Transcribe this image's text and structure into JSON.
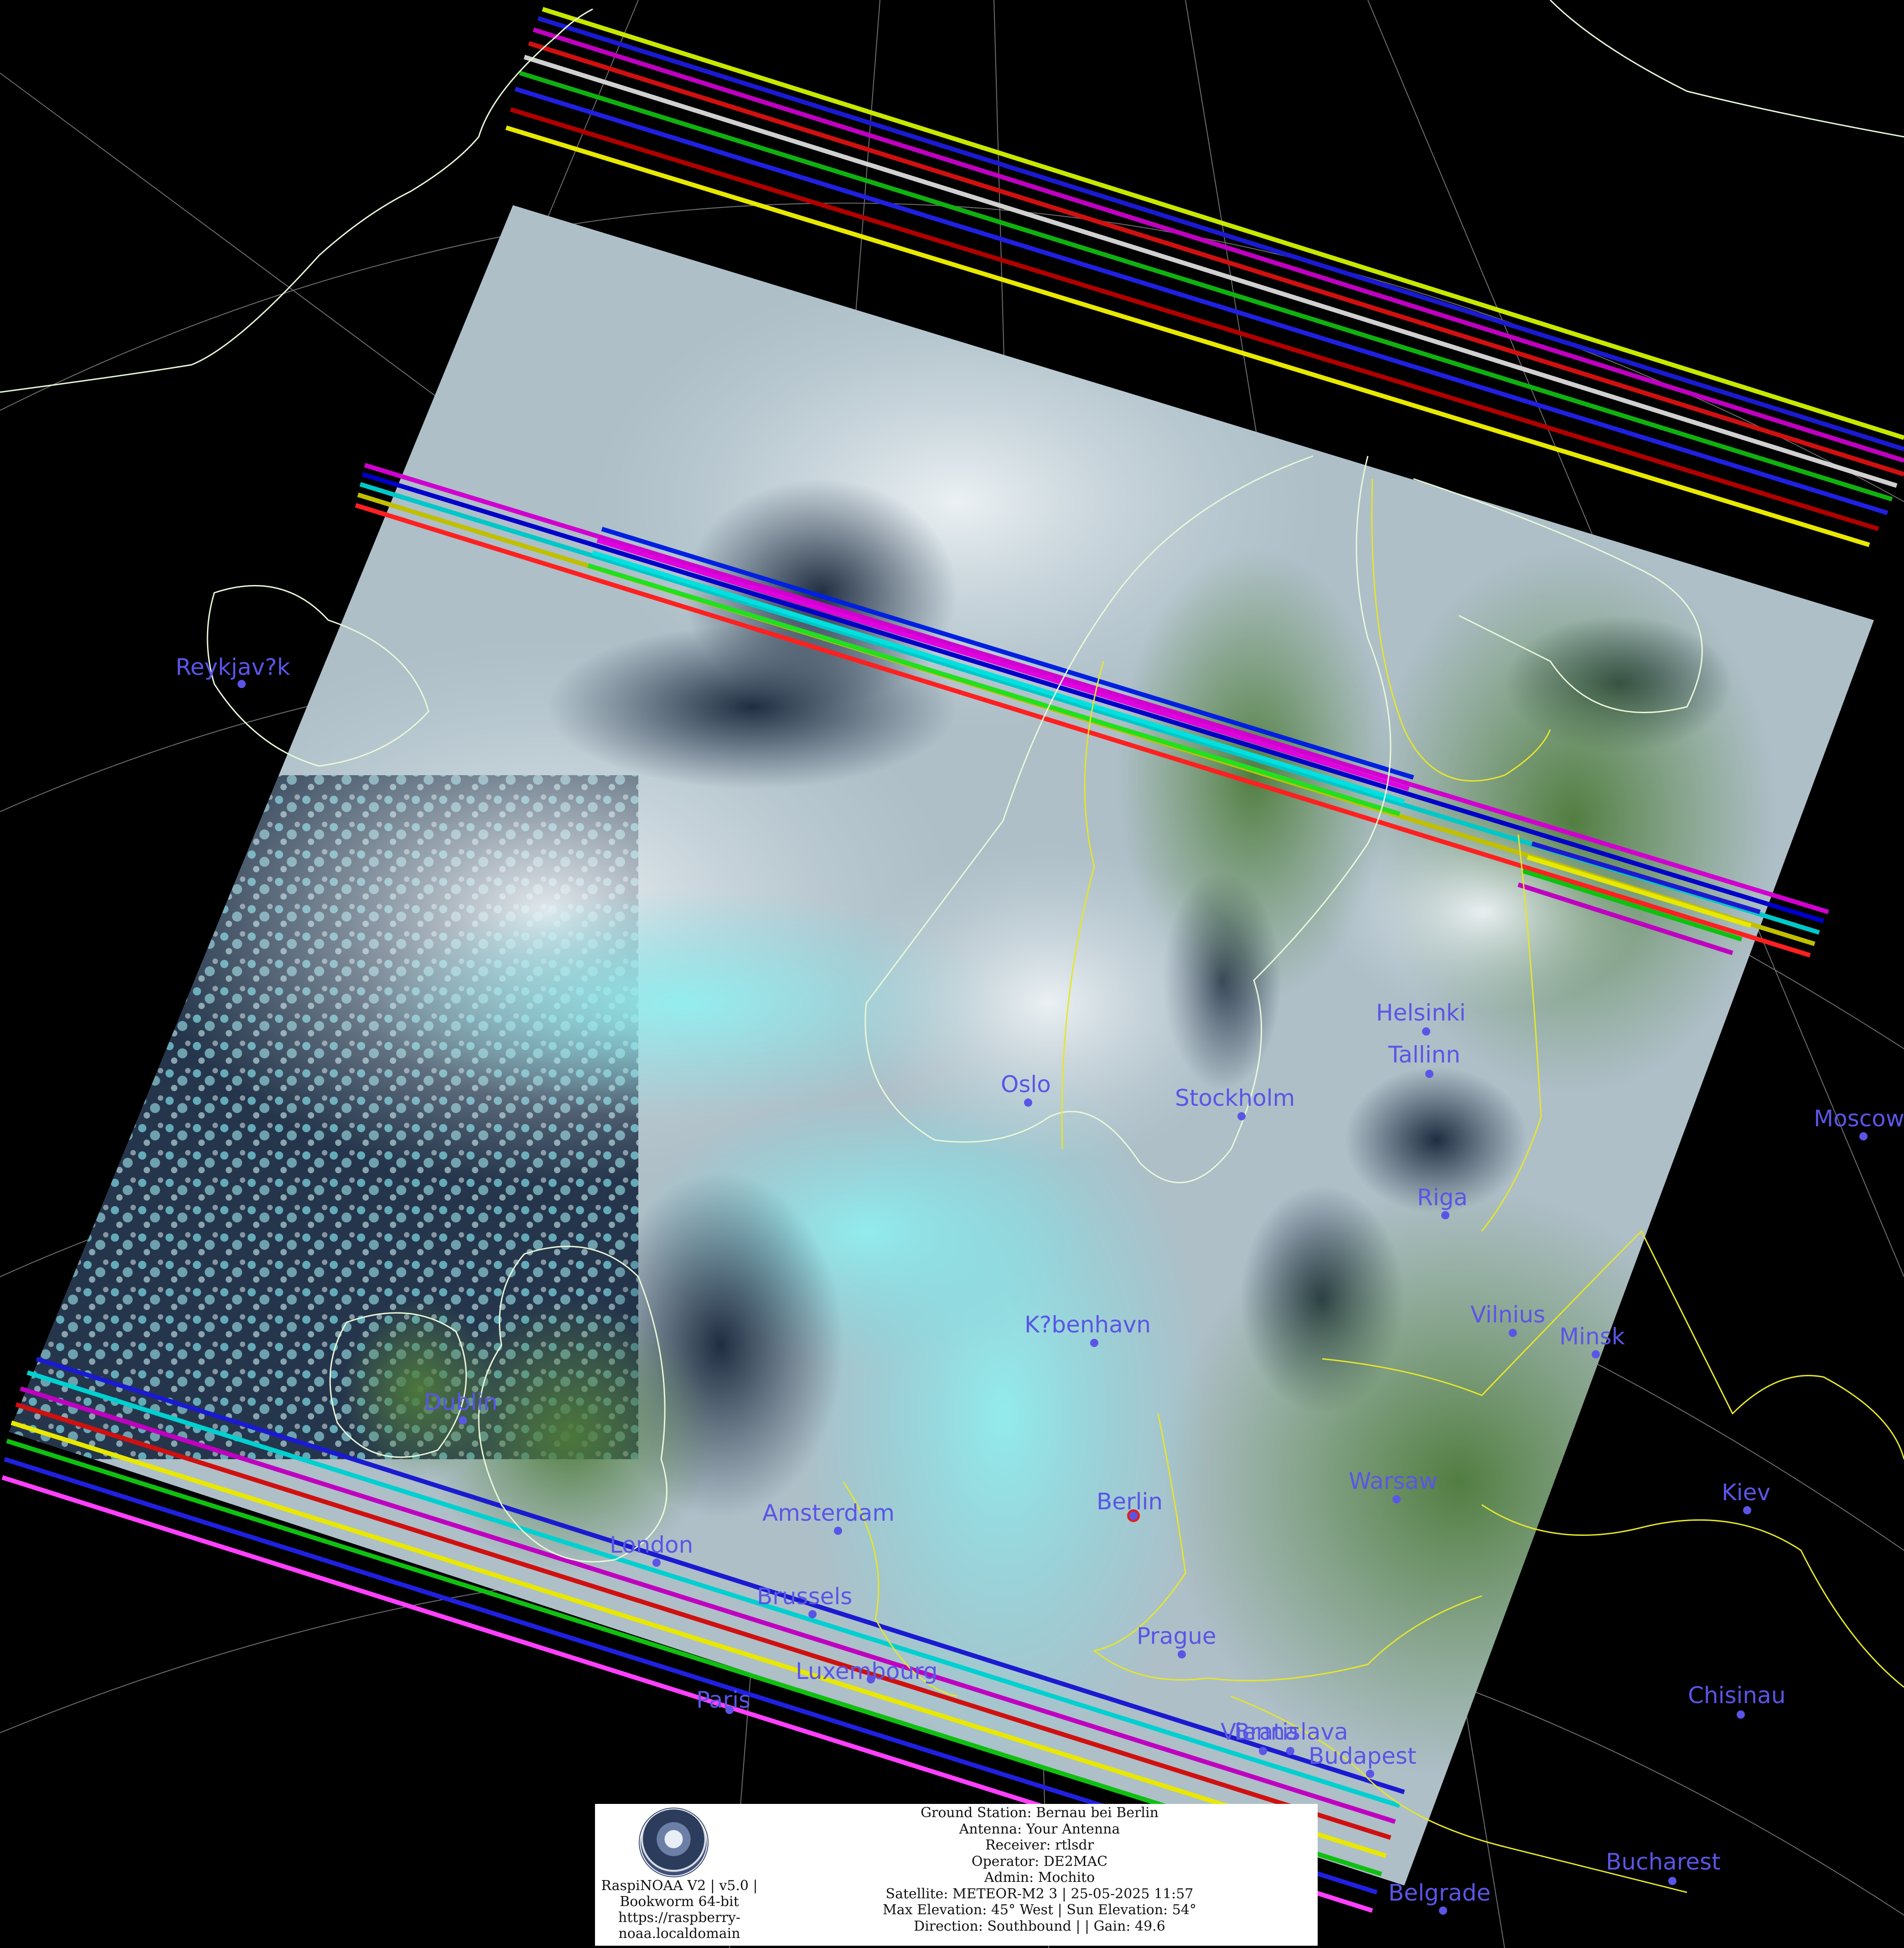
{
  "image": {
    "type": "satellite-pass-composite",
    "description_colors": {
      "background": "#000000",
      "coastline": "#e9f7d9",
      "borders": "#e6e62a",
      "graticule": "#9a9a9a",
      "city_marker": "#5a55e6",
      "station_marker": "#e02020"
    }
  },
  "cities": [
    {
      "name": "Reykjav?k"
    },
    {
      "name": "Oslo"
    },
    {
      "name": "Stockholm"
    },
    {
      "name": "Helsinki"
    },
    {
      "name": "Tallinn"
    },
    {
      "name": "Moscow"
    },
    {
      "name": "Riga"
    },
    {
      "name": "K?benhavn"
    },
    {
      "name": "Vilnius"
    },
    {
      "name": "Minsk"
    },
    {
      "name": "Dublin"
    },
    {
      "name": "Berlin"
    },
    {
      "name": "Warsaw"
    },
    {
      "name": "Kiev"
    },
    {
      "name": "Amsterdam"
    },
    {
      "name": "London"
    },
    {
      "name": "Brussels"
    },
    {
      "name": "Prague"
    },
    {
      "name": "Luxembourg"
    },
    {
      "name": "Paris"
    },
    {
      "name": "Chisinau"
    },
    {
      "name": "Vienna"
    },
    {
      "name": "Bratislava"
    },
    {
      "name": "Budapest"
    },
    {
      "name": "Bucharest"
    },
    {
      "name": "Belgrade"
    }
  ],
  "info_panel": {
    "brand_lines": [
      "RaspiNOAA V2 | v5.0 |",
      "Bookworm 64-bit",
      "https://raspberry-",
      "noaa.localdomain"
    ],
    "station_lines": [
      "Ground Station: Bernau bei Berlin",
      "Antenna: Your Antenna",
      "Receiver: rtlsdr",
      "Operator: DE2MAC",
      "Admin: Mochito",
      "Satellite: METEOR-M2 3 | 25-05-2025 11:57",
      "Max Elevation: 45° West | Sun Elevation: 54°",
      "Direction: Southbound | | Gain: 49.6"
    ]
  }
}
